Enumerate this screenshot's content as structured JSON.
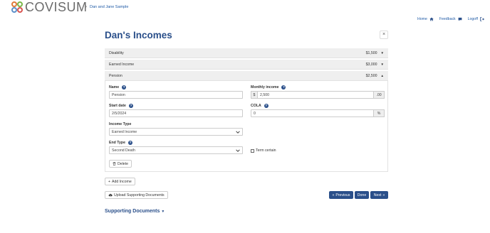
{
  "header": {
    "logo_text": "COVISUM",
    "breadcrumb": "Dan and Jane Sample",
    "nav": [
      {
        "label": "Home",
        "icon": "home-icon"
      },
      {
        "label": "Feedback",
        "icon": "chat-icon"
      },
      {
        "label": "Logoff",
        "icon": "logout-icon"
      }
    ]
  },
  "page": {
    "title": "Dan's Incomes",
    "close_label": "×"
  },
  "incomes": [
    {
      "label": "Disability",
      "amount": "$1,500"
    },
    {
      "label": "Earned Income",
      "amount": "$3,000"
    },
    {
      "label": "Pension",
      "amount": "$2,500"
    }
  ],
  "form": {
    "name_label": "Name",
    "name_value": "Pension",
    "monthly_label": "Monthly income",
    "monthly_prefix": "$",
    "monthly_value": "2,500",
    "monthly_suffix": ".00",
    "start_label": "Start date",
    "start_value": "2/5/2024",
    "cola_label": "COLA",
    "cola_value": "0",
    "cola_suffix": "%",
    "income_type_label": "Income Type",
    "income_type_value": "Earned Income",
    "end_type_label": "End Type",
    "end_type_value": "Second Death",
    "term_certain_label": "Term certain",
    "delete_label": "Delete"
  },
  "actions": {
    "add_income": "Add Income",
    "upload": "Upload Supporting Documents",
    "previous": "Previous",
    "done": "Done",
    "next": "Next"
  },
  "supporting_documents": "Supporting Documents"
}
